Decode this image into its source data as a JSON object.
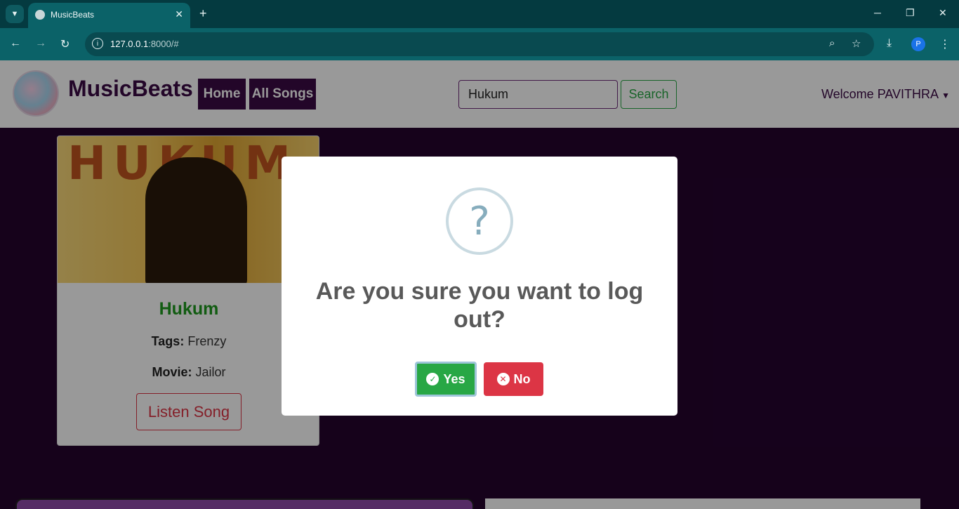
{
  "browser": {
    "tab_title": "MusicBeats",
    "url_host": "127.0.0.1",
    "url_rest": ":8000/#",
    "icons": [
      "tab-list-icon",
      "globe-icon",
      "close-icon",
      "plus-icon",
      "back-icon",
      "forward-icon",
      "reload-icon",
      "info-icon",
      "zoom-icon",
      "star-icon",
      "download-icon",
      "menu-icon"
    ],
    "profile_initial": "P"
  },
  "navbar": {
    "brand": "MusicBeats",
    "links": [
      {
        "label": "Home"
      },
      {
        "label": "All Songs"
      }
    ],
    "search_value": "Hukum",
    "search_button": "Search",
    "welcome": "Welcome PAVITHRA"
  },
  "song_card": {
    "poster_text": "HUKUM",
    "title": "Hukum",
    "tags_label": "Tags:",
    "tags_value": "Frenzy",
    "movie_label": "Movie:",
    "movie_value": "Jailor",
    "listen_button": "Listen Song"
  },
  "modal": {
    "icon": "?",
    "title": "Are you sure you want to log out?",
    "yes_label": "Yes",
    "no_label": "No"
  },
  "colors": {
    "brand_purple": "#3b0a45",
    "page_bg": "#25042e",
    "success": "#28a745",
    "danger": "#dc3545"
  }
}
